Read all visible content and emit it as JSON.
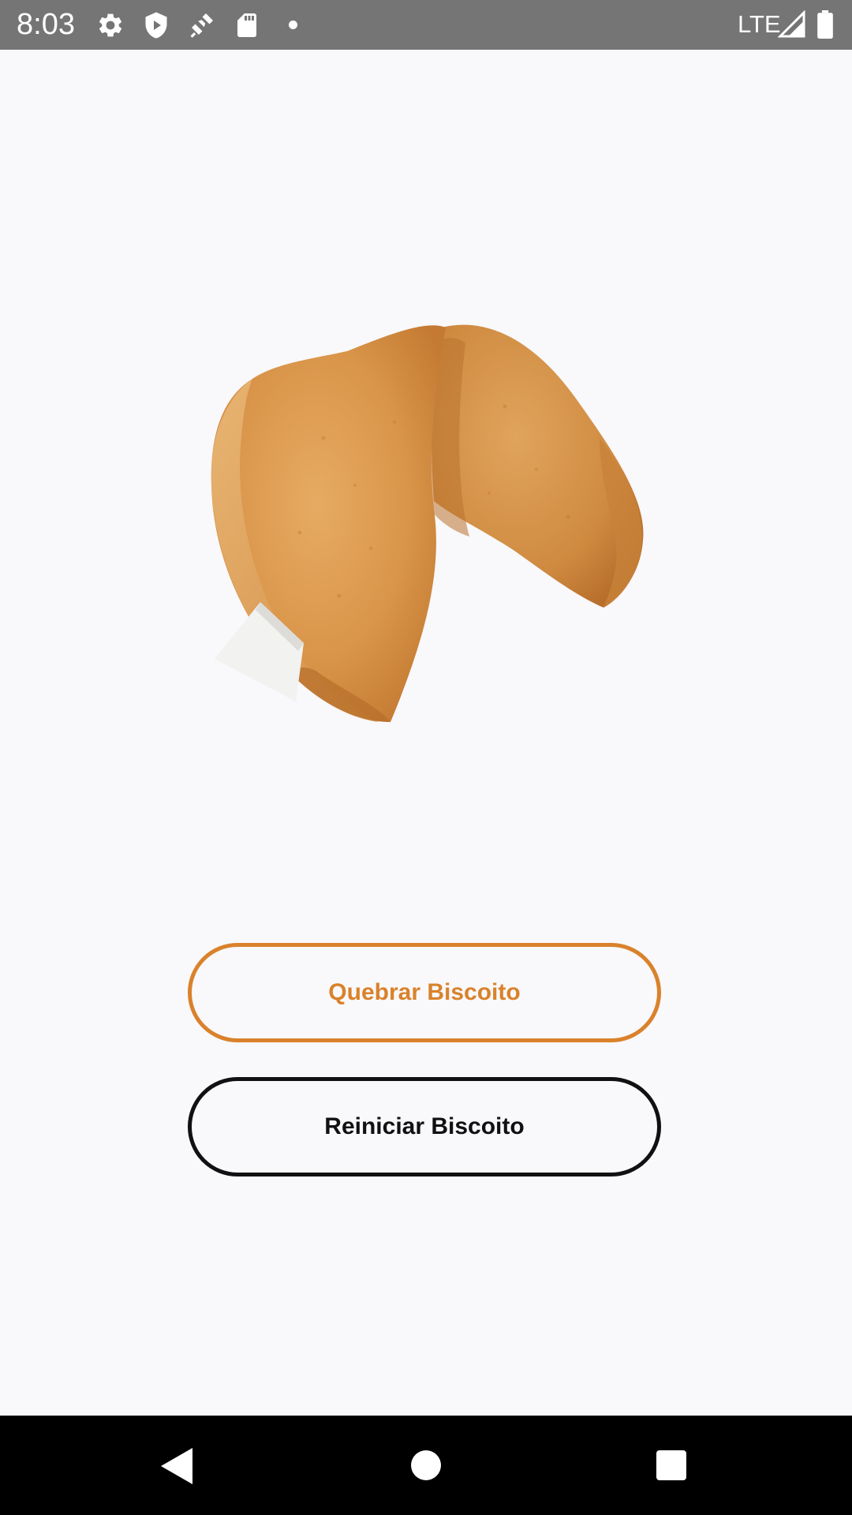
{
  "status_bar": {
    "time": "8:03",
    "network": "LTE",
    "icons": [
      "gear-icon",
      "shield-icon",
      "satellite-icon",
      "sd-card-icon",
      "notification-dot-icon",
      "signal-icon",
      "battery-icon"
    ]
  },
  "main": {
    "image": "fortune-cookie",
    "break_button_label": "Quebrar Biscoito",
    "reset_button_label": "Reiniciar Biscoito"
  },
  "colors": {
    "accent": "#d9822b",
    "dark": "#111111",
    "background": "#f9f8fb",
    "status_bar": "#757575"
  },
  "nav_bar": {
    "icons": [
      "back-icon",
      "home-icon",
      "recents-icon"
    ]
  }
}
